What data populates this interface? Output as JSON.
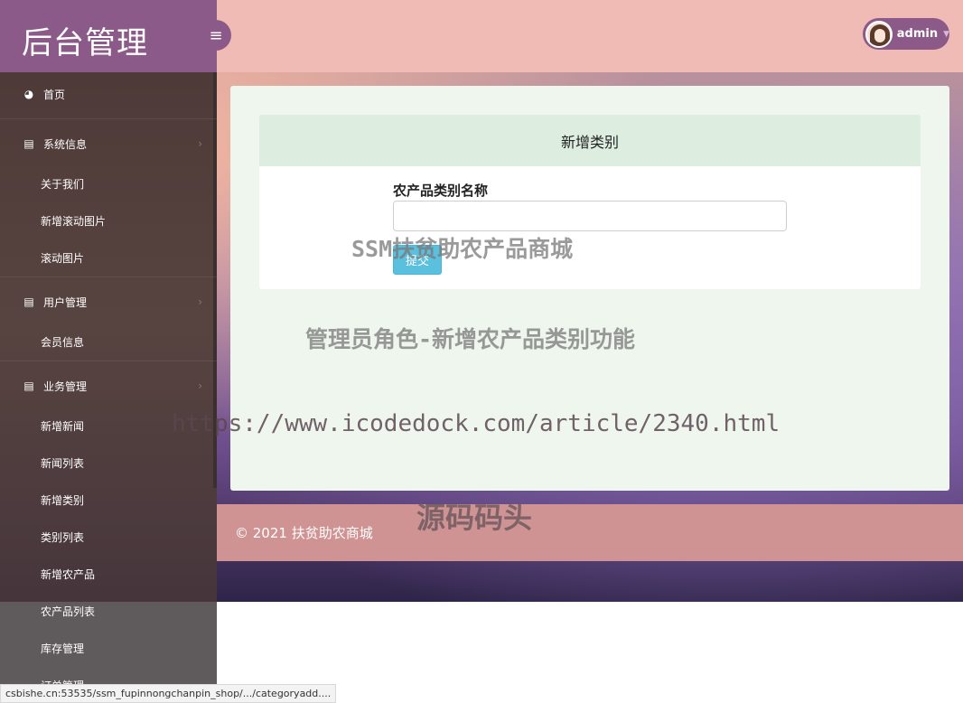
{
  "app": {
    "logo": "后台管理"
  },
  "header": {
    "toggle_icon": "bars-icon",
    "user_name": "admin"
  },
  "sidebar": {
    "home": "首页",
    "groups": [
      {
        "label": "系统信息",
        "items": [
          "关于我们",
          "新增滚动图片",
          "滚动图片"
        ]
      },
      {
        "label": "用户管理",
        "items": [
          "会员信息"
        ]
      },
      {
        "label": "业务管理",
        "items": [
          "新增新闻",
          "新闻列表",
          "新增类别",
          "类别列表",
          "新增农产品",
          "农产品列表",
          "库存管理",
          "订单管理"
        ]
      }
    ]
  },
  "form": {
    "title": "新增类别",
    "label": "农产品类别名称",
    "value": "",
    "submit": "提交"
  },
  "footer": {
    "text": "© 2021 扶贫助农商城"
  },
  "watermarks": {
    "w1": "SSM扶贫助农产品商城",
    "w2": "管理员角色-新增农产品类别功能",
    "w3": "https://www.icodedock.com/article/2340.html",
    "w4": "源码码头"
  },
  "status_url": "csbishe.cn:53535/ssm_fupinnongchanpin_shop/.../categoryadd...."
}
